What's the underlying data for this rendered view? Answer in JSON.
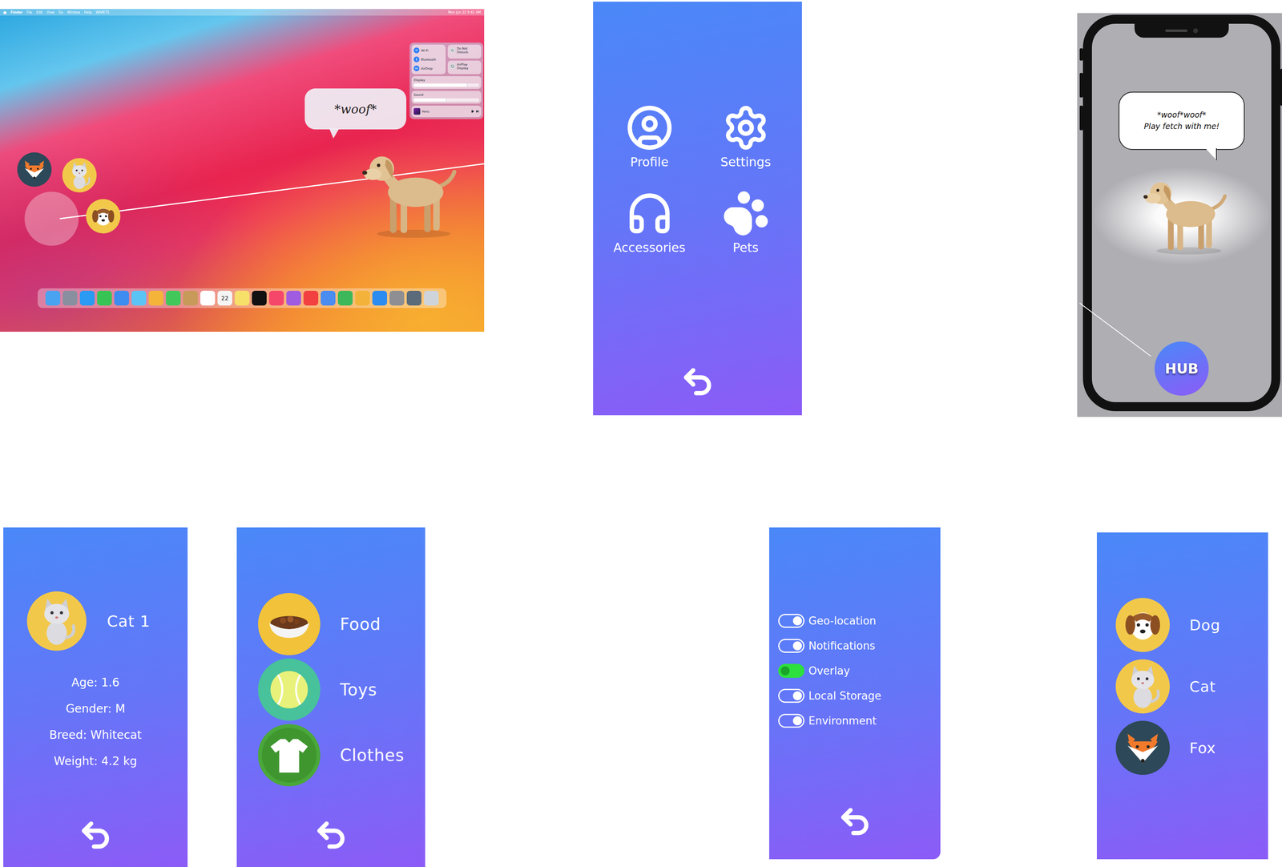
{
  "desktop": {
    "menu_bar": {
      "items": [
        "Finder",
        "File",
        "Edit",
        "View",
        "Go",
        "Window",
        "Help",
        "WAPETS"
      ],
      "clock": "Mon Jun 22  9:41 AM"
    },
    "control_center": {
      "network": [
        {
          "label": "Wi-Fi",
          "on": true
        },
        {
          "label": "Bluetooth",
          "on": true
        },
        {
          "label": "AirDrop",
          "on": true
        }
      ],
      "toggles": [
        {
          "label": "Do Not Disturb",
          "on": false
        },
        {
          "label": "AirPlay Display",
          "on": false
        }
      ],
      "sliders": [
        {
          "label": "Display",
          "level": 0.82
        },
        {
          "label": "Sound",
          "level": 0.5
        }
      ],
      "now_playing": {
        "title": "Hero"
      }
    },
    "bubble": "*woof*",
    "pets": [
      {
        "kind": "fox"
      },
      {
        "kind": "cat"
      },
      {
        "kind": "dog"
      }
    ],
    "dock": {
      "calendar_day": "22"
    }
  },
  "hub_menu": {
    "items": [
      {
        "label": "Profile",
        "kind": "profile"
      },
      {
        "label": "Settings",
        "kind": "settings"
      },
      {
        "label": "Accessories",
        "kind": "accessories"
      },
      {
        "label": "Pets",
        "kind": "pets"
      }
    ]
  },
  "phone": {
    "bubble": [
      "*woof*woof*",
      "Play fetch with me!"
    ],
    "hub_button": "HUB"
  },
  "profile": {
    "pet": {
      "name": "Cat 1",
      "kind": "cat"
    },
    "stats": [
      "Age: 1.6",
      "Gender: M",
      "Breed: Whitecat",
      "Weight: 4.2 kg"
    ]
  },
  "accessories": {
    "items": [
      {
        "label": "Food",
        "kind": "food"
      },
      {
        "label": "Toys",
        "kind": "toys"
      },
      {
        "label": "Clothes",
        "kind": "clothes"
      }
    ]
  },
  "settings": {
    "toggles": [
      {
        "label": "Geo-location",
        "on": false
      },
      {
        "label": "Notifications",
        "on": false
      },
      {
        "label": "Overlay",
        "on": true
      },
      {
        "label": "Local Storage",
        "on": false
      },
      {
        "label": "Environment",
        "on": false
      }
    ]
  },
  "pets": {
    "items": [
      {
        "label": "Dog",
        "kind": "dog"
      },
      {
        "label": "Cat",
        "kind": "cat"
      },
      {
        "label": "Fox",
        "kind": "fox"
      }
    ]
  }
}
